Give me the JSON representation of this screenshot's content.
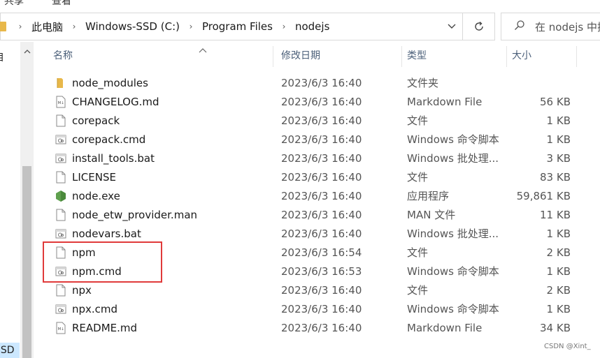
{
  "menu": {
    "left": "共享",
    "right": "查看"
  },
  "address": {
    "breadcrumbs": [
      "此电脑",
      "Windows-SSD (C:)",
      "Program Files",
      "nodejs"
    ]
  },
  "search": {
    "placeholder": "在 nodejs 中搜"
  },
  "nav": {
    "top_item": "目",
    "bottom_item": "SSD"
  },
  "columns": {
    "name": "名称",
    "date": "修改日期",
    "type": "类型",
    "size": "大小"
  },
  "files": [
    {
      "name": "node_modules",
      "date": "2023/6/3 16:40",
      "type": "文件夹",
      "size": "",
      "icon": "folder-icon"
    },
    {
      "name": "CHANGELOG.md",
      "date": "2023/6/3 16:40",
      "type": "Markdown File",
      "size": "56 KB",
      "icon": "markdown-file-icon"
    },
    {
      "name": "corepack",
      "date": "2023/6/3 16:40",
      "type": "文件",
      "size": "1 KB",
      "icon": "file-icon"
    },
    {
      "name": "corepack.cmd",
      "date": "2023/6/3 16:40",
      "type": "Windows 命令脚本",
      "size": "1 KB",
      "icon": "script-file-icon"
    },
    {
      "name": "install_tools.bat",
      "date": "2023/6/3 16:40",
      "type": "Windows 批处理...",
      "size": "3 KB",
      "icon": "script-file-icon"
    },
    {
      "name": "LICENSE",
      "date": "2023/6/3 16:40",
      "type": "文件",
      "size": "83 KB",
      "icon": "file-icon"
    },
    {
      "name": "node.exe",
      "date": "2023/6/3 16:40",
      "type": "应用程序",
      "size": "59,861 KB",
      "icon": "nodejs-hexagon-icon"
    },
    {
      "name": "node_etw_provider.man",
      "date": "2023/6/3 16:40",
      "type": "MAN 文件",
      "size": "11 KB",
      "icon": "file-icon"
    },
    {
      "name": "nodevars.bat",
      "date": "2023/6/3 16:40",
      "type": "Windows 批处理...",
      "size": "1 KB",
      "icon": "script-file-icon"
    },
    {
      "name": "npm",
      "date": "2023/6/3 16:54",
      "type": "文件",
      "size": "2 KB",
      "icon": "file-icon"
    },
    {
      "name": "npm.cmd",
      "date": "2023/6/3 16:53",
      "type": "Windows 命令脚本",
      "size": "1 KB",
      "icon": "script-file-icon"
    },
    {
      "name": "npx",
      "date": "2023/6/3 16:40",
      "type": "文件",
      "size": "2 KB",
      "icon": "file-icon"
    },
    {
      "name": "npx.cmd",
      "date": "2023/6/3 16:40",
      "type": "Windows 命令脚本",
      "size": "1 KB",
      "icon": "script-file-icon"
    },
    {
      "name": "README.md",
      "date": "2023/6/3 16:40",
      "type": "Markdown File",
      "size": "34 KB",
      "icon": "markdown-file-icon"
    }
  ],
  "watermark": "CSDN @Xint_",
  "colors": {
    "highlight": "#e03a3a",
    "folder": "#e8b84a",
    "node_green": "#5fa04e",
    "header_text": "#4c607a"
  }
}
